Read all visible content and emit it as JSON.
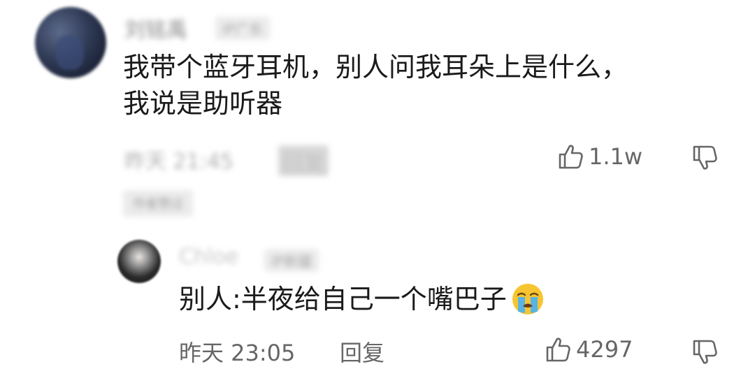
{
  "comment": {
    "username": "刘铭禹",
    "ip_location": "IP广东",
    "text_line1": "我带个蓝牙耳机，别人问我耳朵上是什么，",
    "text_line2": "我说是助听器",
    "time": "昨天 21:45",
    "reply_label": "回复",
    "like_count": "1.1w",
    "author_badge": "作者赞过"
  },
  "reply": {
    "username": "Chloe",
    "ip_location": "IP新疆",
    "text": "别人:半夜给自己一个嘴巴子",
    "emoji": "loudly-crying-face",
    "time": "昨天 23:05",
    "reply_label": "回复",
    "like_count": "4297"
  },
  "icons": {
    "like": "thumbs-up-outline-icon",
    "dislike": "thumbs-down-outline-icon"
  },
  "colors": {
    "text_primary": "#1a1a1a",
    "text_meta": "#666666",
    "background": "#ffffff"
  }
}
